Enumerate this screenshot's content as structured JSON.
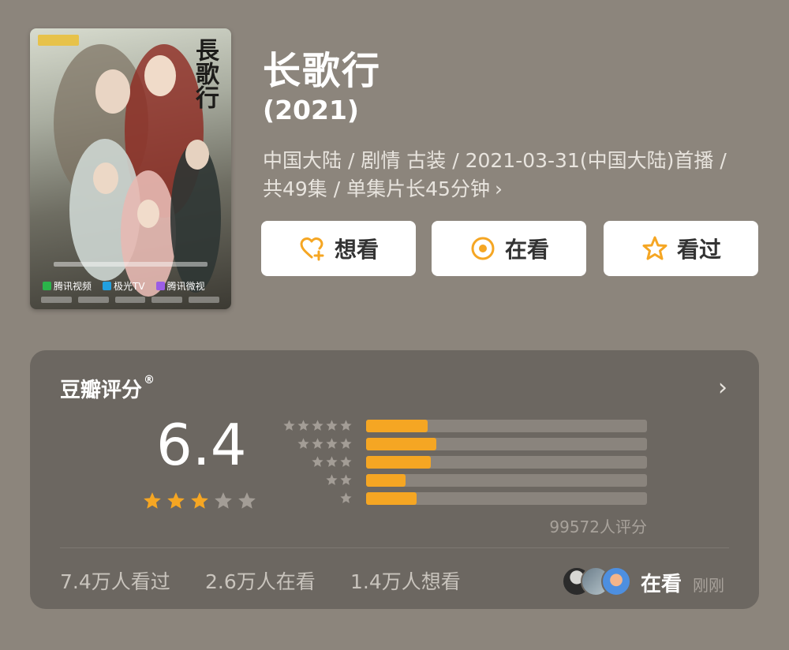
{
  "header": {
    "title": "长歌行",
    "year": "(2021)",
    "meta_line": "中国大陆 / 剧情 古装 / 2021-03-31(中国大陆)首播 / 共49集 / 单集片长45分钟",
    "meta_chevron": "›"
  },
  "poster": {
    "calligraphy": "長歌行",
    "streams": [
      {
        "label": "腾讯视频",
        "color": "#2bb44a"
      },
      {
        "label": "极光TV",
        "color": "#22a0e0"
      },
      {
        "label": "腾讯微视",
        "color": "#9b5de5"
      }
    ]
  },
  "actions": {
    "want_label": "想看",
    "watching_label": "在看",
    "watched_label": "看过",
    "accent": "#f5a623"
  },
  "rating": {
    "title": "豆瓣评分",
    "title_mark": "®",
    "chevron": "›",
    "score": "6.4",
    "score_stars_filled": 3,
    "score_stars_total": 5,
    "distribution": [
      {
        "stars": 5,
        "fraction": 0.22
      },
      {
        "stars": 4,
        "fraction": 0.25
      },
      {
        "stars": 3,
        "fraction": 0.23
      },
      {
        "stars": 2,
        "fraction": 0.14
      },
      {
        "stars": 1,
        "fraction": 0.18
      }
    ],
    "count_label": "99572人评分",
    "bar_color": "#f5a623"
  },
  "stats": {
    "watched": "7.4万人看过",
    "watching": "2.6万人在看",
    "want": "1.4万人想看"
  },
  "friends": {
    "status": "在看",
    "time": "刚刚"
  }
}
